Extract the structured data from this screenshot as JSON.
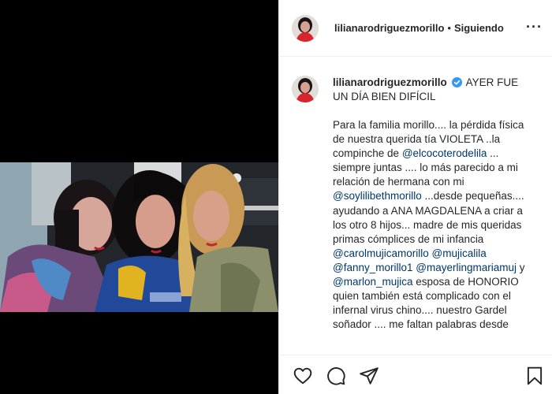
{
  "post": {
    "username": "lilianarodriguezmorillo",
    "follow_separator": "•",
    "follow_status": "Siguiendo",
    "more_label": "···"
  },
  "caption": {
    "username": "lilianarodriguezmorillo",
    "headline": "AYER FUE UN DÍA BIEN DIFÍCIL",
    "body_segments": [
      {
        "type": "text",
        "value": "Para la familia morillo.... la pérdida física de nuestra querida tía VIOLETA ..la compinche de "
      },
      {
        "type": "mention",
        "value": "@elcocoterodelila"
      },
      {
        "type": "text",
        "value": " ... siempre juntas .... lo más parecido a mi relación de hermana con mi "
      },
      {
        "type": "mention",
        "value": "@soylilibethmorillo"
      },
      {
        "type": "text",
        "value": " ...desde pequeñas.... ayudando a ANA MAGDALENA a criar a los otro 8 hijos... madre de mis queridas primas cómplices de mi infancia "
      },
      {
        "type": "mention",
        "value": "@carolmujicamorillo"
      },
      {
        "type": "text",
        "value": " "
      },
      {
        "type": "mention",
        "value": "@mujicalila"
      },
      {
        "type": "text",
        "value": " "
      },
      {
        "type": "mention",
        "value": "@fanny_morillo1"
      },
      {
        "type": "text",
        "value": " "
      },
      {
        "type": "mention",
        "value": "@mayerlingmariamuj"
      },
      {
        "type": "text",
        "value": " y "
      },
      {
        "type": "mention",
        "value": "@marlon_mujica"
      },
      {
        "type": "text",
        "value": " esposa de HONORIO quien también está complicado con el infernal virus chino.... nuestro Gardel soñador .... me faltan palabras desde"
      }
    ]
  },
  "actions": {
    "like": "heart-icon",
    "comment": "comment-icon",
    "share": "share-icon",
    "save": "bookmark-icon"
  },
  "colors": {
    "text": "#262626",
    "mention": "#00376b",
    "verified": "#3897f0",
    "border": "#efefef"
  }
}
